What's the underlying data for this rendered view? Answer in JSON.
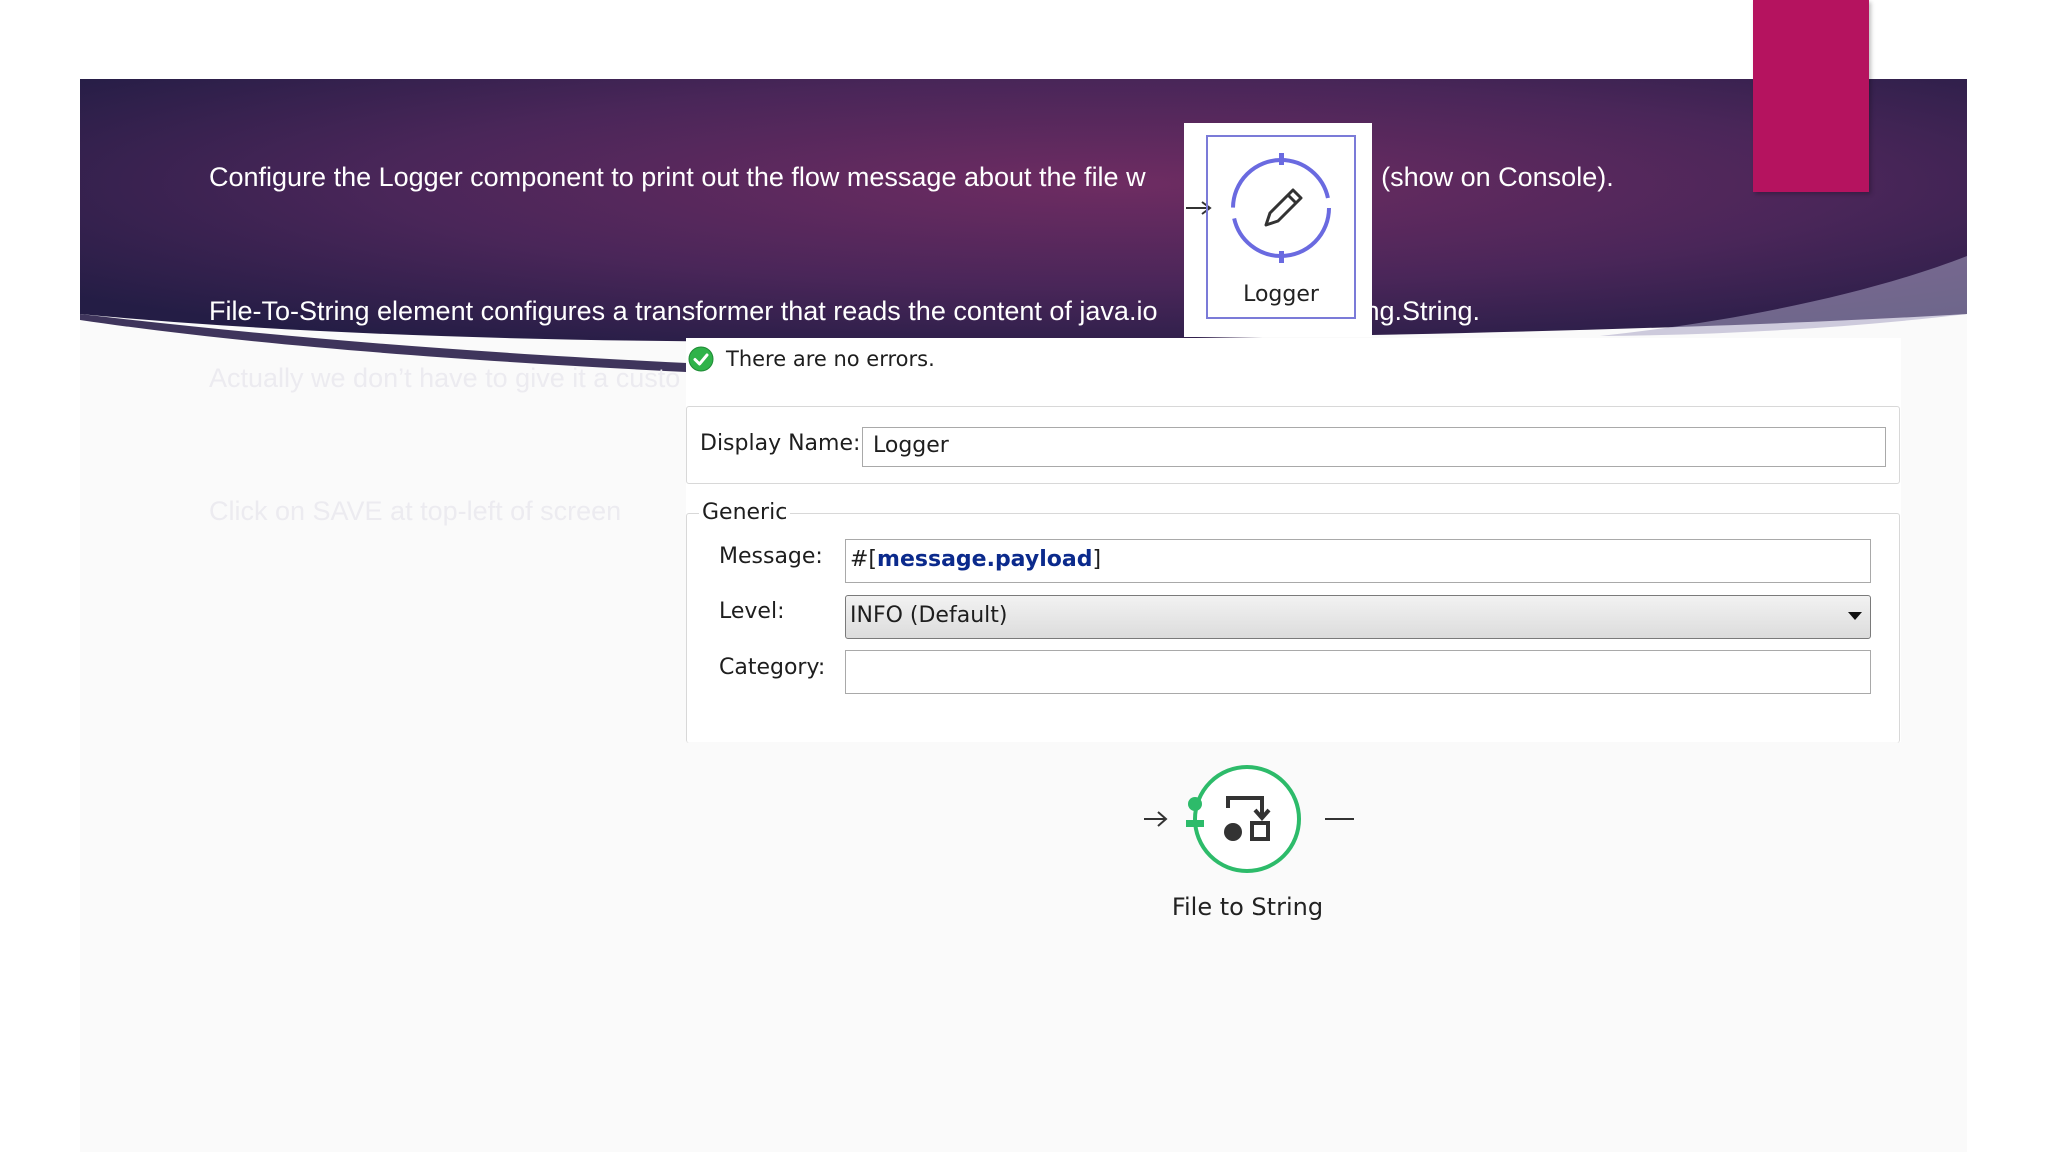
{
  "slide": {
    "line1": "Configure the Logger component to print out the flow message about the file w",
    "line1_tail": "g (show on Console).",
    "line2": "File-To-String element configures a transformer that reads the content of java.io",
    "line2_tail": "lang.String.",
    "line3": "Actually we don’t have to give it a custo",
    "line4": "Click on SAVE at top-left of screen"
  },
  "colors": {
    "banner_dark": "#2a1f4a",
    "banner_mid": "#6a2a5e",
    "accent": "#b5135f",
    "success": "#2fb34a",
    "node_green": "#2dbb6a",
    "logger_blue": "#6a6ae0"
  },
  "logger_node": {
    "label": "Logger",
    "icon": "pencil-icon"
  },
  "properties": {
    "status": "There are no errors.",
    "display_name_label": "Display Name:",
    "display_name_value": "Logger",
    "generic_title": "Generic",
    "message_label": "Message:",
    "message_prefix": "#[",
    "message_expr": "message.payload",
    "message_suffix": "]",
    "level_label": "Level:",
    "level_value": "INFO (Default)",
    "category_label": "Category:",
    "category_value": ""
  },
  "fts_node": {
    "label": "File to String",
    "icon": "transform-icon"
  }
}
